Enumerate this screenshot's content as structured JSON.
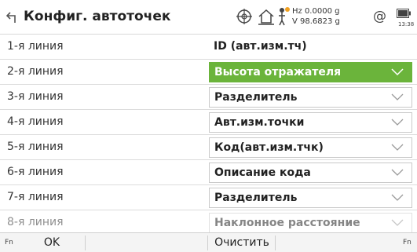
{
  "header": {
    "title": "Конфиг. автоточек",
    "hz": "Hz 0.0000 g",
    "v": "V 98.6823 g",
    "battery_time": "13:38",
    "at_symbol": "@"
  },
  "rows": [
    {
      "label": "1-я линия",
      "value": "ID (авт.изм.тч)",
      "kind": "static"
    },
    {
      "label": "2-я линия",
      "value": "Высота отражателя",
      "kind": "selected"
    },
    {
      "label": "3-я линия",
      "value": "Разделитель",
      "kind": "dropdown"
    },
    {
      "label": "4-я линия",
      "value": "Авт.изм.точки",
      "kind": "dropdown"
    },
    {
      "label": "5-я линия",
      "value": "Код(авт.изм.тчк)",
      "kind": "dropdown"
    },
    {
      "label": "6-я линия",
      "value": "Описание кода",
      "kind": "dropdown"
    },
    {
      "label": "7-я линия",
      "value": "Разделитель",
      "kind": "dropdown"
    },
    {
      "label": "8-я линия",
      "value": "Наклонное расстояние",
      "kind": "dropdown"
    }
  ],
  "footer": {
    "fn_left": "Fn",
    "fn_right": "Fn",
    "ok_label": "OK",
    "clear_label": "Очистить"
  },
  "colors": {
    "accent": "#6bb43b"
  }
}
